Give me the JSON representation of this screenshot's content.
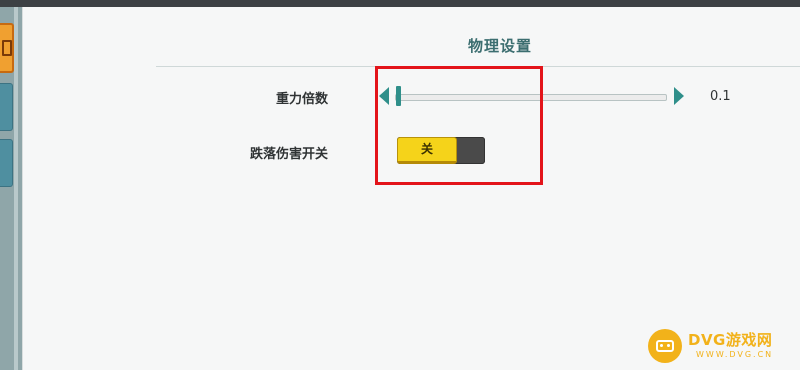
{
  "section": {
    "title": "物理设置"
  },
  "settings": {
    "gravity": {
      "label": "重力倍数",
      "value": "0.1",
      "position_fraction": 0.01
    },
    "fall_damage": {
      "label": "跌落伤害开关",
      "state_label": "关",
      "enabled": false
    }
  },
  "watermark": {
    "title": "DVG游戏网",
    "url": "WWW.DVG.CN"
  },
  "colors": {
    "accent": "#2f8f8a",
    "toggle_on": "#f5d31a",
    "highlight": "#e3141a",
    "title": "#3c6e70",
    "watermark": "#f2b21a"
  },
  "icons": {
    "slider_left": "triangle-left-icon",
    "slider_right": "triangle-right-icon",
    "logo": "gamepad-icon"
  }
}
